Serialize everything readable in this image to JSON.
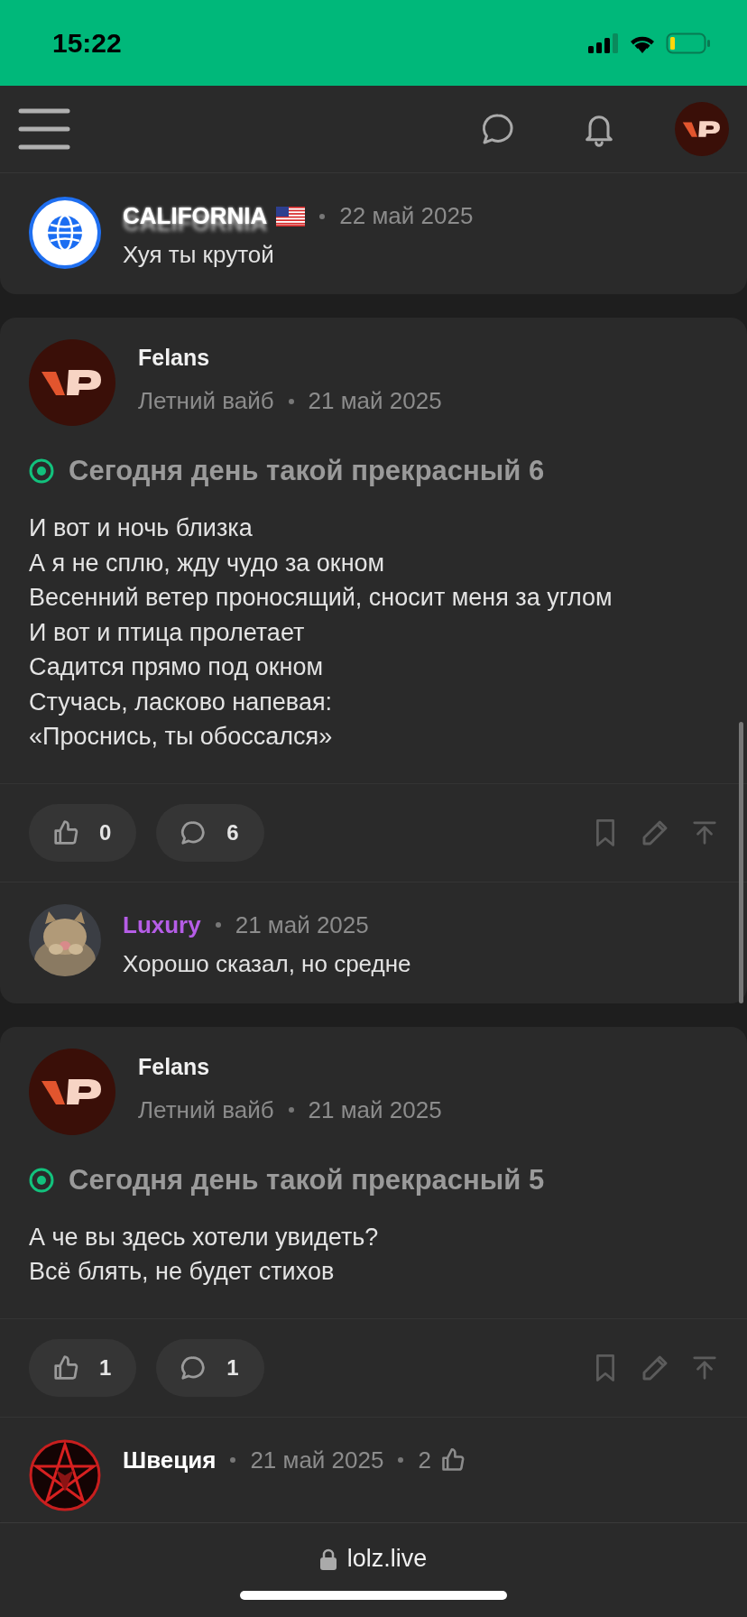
{
  "status_bar": {
    "time": "15:22"
  },
  "feed": [
    {
      "kind": "comment",
      "avatar": {
        "kind": "globe"
      },
      "author": "CALIFORNIA",
      "blurred": true,
      "flag": true,
      "color": "#ffffff",
      "date": "22 май 2025",
      "text": "Хуя ты крутой"
    },
    {
      "kind": "post",
      "avatar": {
        "kind": "logo"
      },
      "author": "Felans",
      "status": "Летний вайб",
      "date": "21 май 2025",
      "title": "Сегодня день такой прекрасный 6",
      "body": [
        "И вот и ночь близка",
        "А я не сплю, жду чудо за окном",
        "Весенний ветер проносящий, сносит меня за углом",
        "И вот и птица пролетает",
        "Садится прямо под окном",
        "Стучась, ласково напевая:",
        "«Проснись, ты обоссался»"
      ],
      "likes": "0",
      "comments": "6",
      "reply": {
        "author": "Luxury",
        "color": "#b55de6",
        "date": "21 май 2025",
        "text": "Хорошо сказал, но средне"
      }
    },
    {
      "kind": "post",
      "avatar": {
        "kind": "logo"
      },
      "author": "Felans",
      "status": "Летний вайб",
      "date": "21 май 2025",
      "title": "Сегодня день такой прекрасный 5",
      "body": [
        "А че вы здесь хотели увидеть?",
        "Всё блять, не будет стихов"
      ],
      "likes": "1",
      "comments": "1",
      "reply": {
        "avatar": {
          "kind": "pentagram"
        },
        "author": "Швеция",
        "color": "#ffffff",
        "date": "21 май 2025",
        "likes": "2"
      }
    }
  ],
  "address_bar": {
    "url": "lolz.live"
  }
}
